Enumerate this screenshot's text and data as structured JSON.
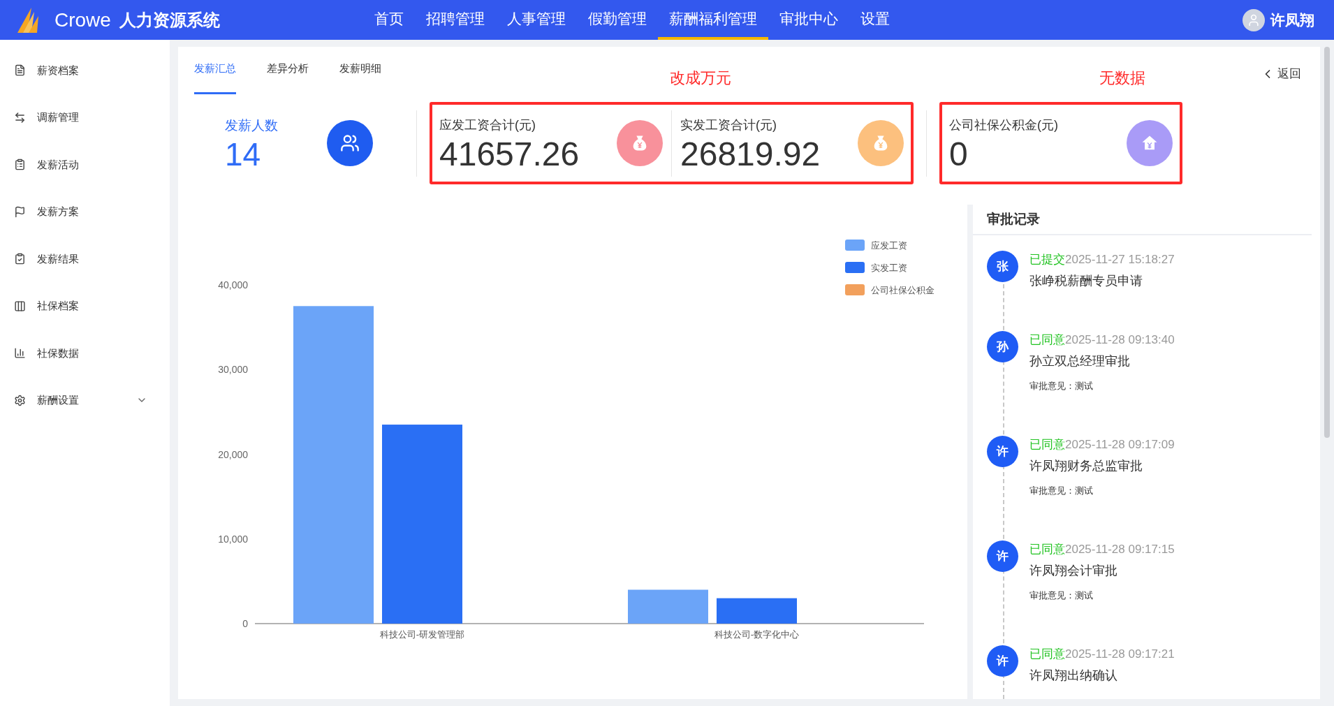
{
  "header": {
    "logo_text": "Crowe",
    "system_name": "人力资源系统",
    "user": "许凤翔",
    "nav": [
      {
        "label": "首页",
        "selected": false
      },
      {
        "label": "招聘管理",
        "selected": false
      },
      {
        "label": "人事管理",
        "selected": false
      },
      {
        "label": "假勤管理",
        "selected": false
      },
      {
        "label": "薪酬福利管理",
        "selected": true
      },
      {
        "label": "审批中心",
        "selected": false
      },
      {
        "label": "设置",
        "selected": false
      }
    ]
  },
  "sidebar": {
    "items": [
      {
        "label": "薪资档案",
        "kind": "link"
      },
      {
        "label": "调薪管理",
        "kind": "link"
      },
      {
        "label": "发薪活动",
        "kind": "link"
      },
      {
        "label": "发薪方案",
        "kind": "link"
      },
      {
        "label": "发薪结果",
        "kind": "link"
      },
      {
        "label": "社保档案",
        "kind": "link"
      },
      {
        "label": "社保数据",
        "kind": "link"
      },
      {
        "label": "薪酬设置",
        "kind": "group"
      }
    ]
  },
  "tabs": [
    {
      "label": "发薪汇总",
      "selected": true
    },
    {
      "label": "差异分析",
      "selected": false
    },
    {
      "label": "发薪明细",
      "selected": false
    }
  ],
  "back": "返回",
  "stat_groups": [
    {
      "marked": false,
      "stats": [
        {
          "kind": "count",
          "label": "发薪人数",
          "value": "14",
          "color": "#1f5cf0"
        }
      ]
    },
    {
      "marked": true,
      "note": "改成万元",
      "stats": [
        {
          "kind": "money",
          "label": "应发工资合计(元)",
          "value": "41657.26",
          "color": "#f8919b"
        },
        {
          "kind": "money",
          "label": "实发工资合计(元)",
          "value": "26819.92",
          "color": "#fcc07e"
        }
      ]
    },
    {
      "marked": true,
      "note": "无数据",
      "stats": [
        {
          "kind": "house",
          "label": "公司社保公积金(元)",
          "value": "0",
          "color": "#a99bf7"
        }
      ]
    }
  ],
  "chart_data": {
    "type": "bar",
    "categories": [
      "科技公司-研发管理部",
      "科技公司-数字化中心"
    ],
    "series": [
      {
        "name": "应发工资",
        "color": "#6ba4f8",
        "values": [
          37500,
          4000
        ]
      },
      {
        "name": "实发工资",
        "color": "#2a6ff4",
        "values": [
          23500,
          3000
        ]
      },
      {
        "name": "公司社保公积金",
        "color": "#f2a05c",
        "values": [
          0,
          0
        ]
      }
    ],
    "legend": true,
    "ylim": [
      0,
      40000
    ],
    "yticks": [
      {
        "value": 0,
        "label": "0"
      },
      {
        "value": 10000,
        "label": "10,000"
      },
      {
        "value": 20000,
        "label": "20,000"
      },
      {
        "value": 30000,
        "label": "30,000"
      },
      {
        "value": 40000,
        "label": "40,000"
      }
    ]
  },
  "approval": {
    "title": "审批记录",
    "records": [
      {
        "avatar": "张",
        "status": "已提交",
        "time": "2025-11-27 15:18:27",
        "text": "张峥税薪酬专员申请"
      },
      {
        "avatar": "孙",
        "status": "已同意",
        "time": "2025-11-28 09:13:40",
        "text": "孙立双总经理审批",
        "comment": "审批意见：测试"
      },
      {
        "avatar": "许",
        "status": "已同意",
        "time": "2025-11-28 09:17:09",
        "text": "许凤翔财务总监审批",
        "comment": "审批意见：测试"
      },
      {
        "avatar": "许",
        "status": "已同意",
        "time": "2025-11-28 09:17:15",
        "text": "许凤翔会计审批",
        "comment": "审批意见：测试"
      },
      {
        "avatar": "许",
        "status": "已同意",
        "time": "2025-11-28 09:17:21",
        "text": "许凤翔出纳确认"
      }
    ]
  }
}
